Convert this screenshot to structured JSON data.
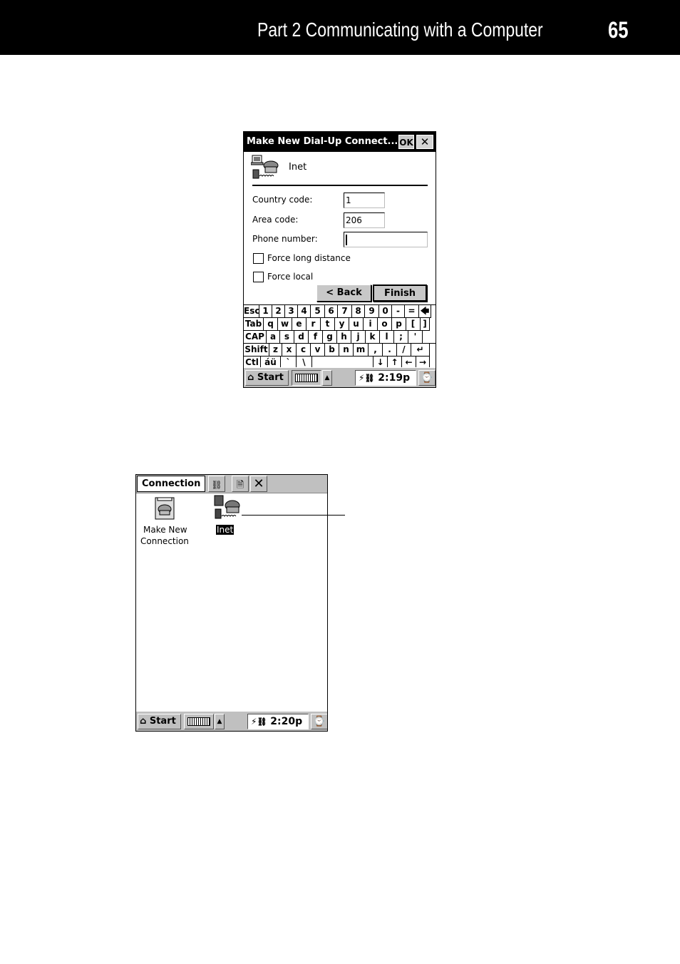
{
  "header": {
    "title": "Part 2  Communicating with a Computer",
    "page_number": "65"
  },
  "dialog_screen": {
    "titlebar": {
      "title": "Make New Dial-Up Connect...",
      "ok_label": "OK",
      "close_label": "✕"
    },
    "connection_name": "Inet",
    "fields": [
      {
        "label": "Country code:",
        "value": "1"
      },
      {
        "label": "Area code:",
        "value": "206"
      },
      {
        "label": "Phone number:",
        "value": ""
      }
    ],
    "checkboxes": [
      {
        "label": "Force long distance",
        "checked": false
      },
      {
        "label": "Force local",
        "checked": false
      }
    ],
    "buttons": {
      "back": "< Back",
      "finish": "Finish"
    },
    "keyboard": {
      "rows": [
        [
          "Esc",
          "1",
          "2",
          "3",
          "4",
          "5",
          "6",
          "7",
          "8",
          "9",
          "0",
          "-",
          "=",
          "🡄"
        ],
        [
          "Tab",
          "q",
          "w",
          "e",
          "r",
          "t",
          "y",
          "u",
          "i",
          "o",
          "p",
          "[",
          "]"
        ],
        [
          "CAP",
          "a",
          "s",
          "d",
          "f",
          "g",
          "h",
          "j",
          "k",
          "l",
          ";",
          "'",
          ""
        ],
        [
          "Shift",
          "z",
          "x",
          "c",
          "v",
          "b",
          "n",
          "m",
          ",",
          ".",
          "/",
          "↵"
        ],
        [
          "Ctl",
          "áü",
          "`",
          "\\",
          " ",
          "↓",
          "↑",
          "←",
          "→"
        ]
      ]
    },
    "taskbar": {
      "start_label": "Start",
      "time": "2:19p"
    }
  },
  "folder_screen": {
    "menu_label": "Connection",
    "icons": [
      {
        "label_line1": "Make New",
        "label_line2": "Connection"
      },
      {
        "label_line1": "Inet",
        "selected": true
      }
    ],
    "taskbar": {
      "start_label": "Start",
      "time": "2:20p"
    }
  }
}
